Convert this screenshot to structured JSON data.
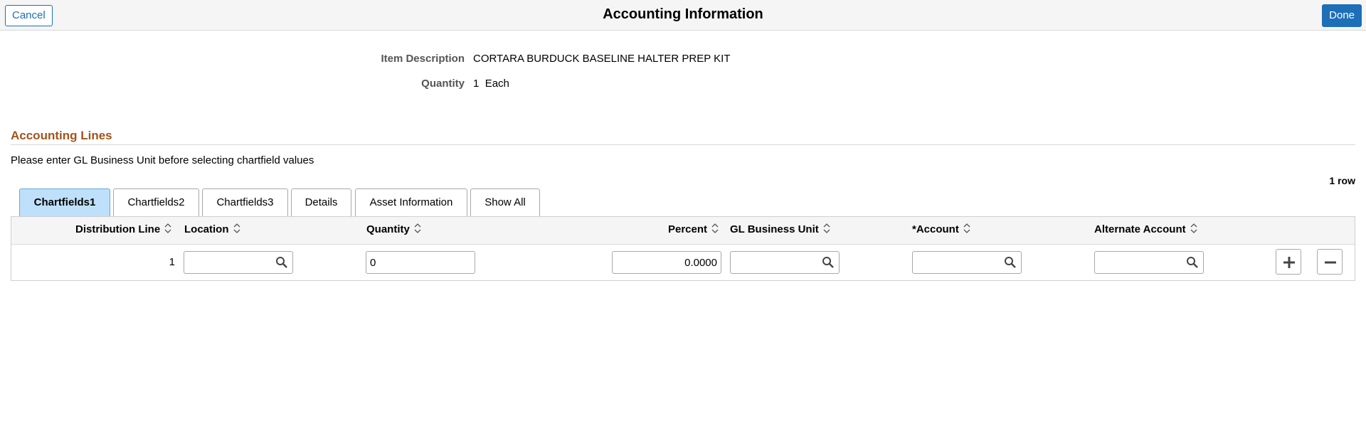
{
  "header": {
    "title": "Accounting Information",
    "cancel_label": "Cancel",
    "done_label": "Done"
  },
  "item_info": {
    "description_label": "Item Description",
    "description_value": "CORTARA BURDUCK BASELINE HALTER PREP KIT",
    "quantity_label": "Quantity",
    "quantity_value": "1",
    "quantity_unit": "Each"
  },
  "accounting_lines": {
    "section_title": "Accounting Lines",
    "instruction": "Please enter GL Business Unit before selecting chartfield values",
    "row_count": "1 row",
    "tabs": [
      {
        "label": "Chartfields1",
        "active": true
      },
      {
        "label": "Chartfields2",
        "active": false
      },
      {
        "label": "Chartfields3",
        "active": false
      },
      {
        "label": "Details",
        "active": false
      },
      {
        "label": "Asset Information",
        "active": false
      },
      {
        "label": "Show All",
        "active": false
      }
    ],
    "columns": {
      "distribution_line": "Distribution Line",
      "location": "Location",
      "quantity": "Quantity",
      "percent": "Percent",
      "gl_business_unit": "GL Business Unit",
      "account": "*Account",
      "alternate_account": "Alternate Account"
    },
    "rows": [
      {
        "distribution_line": "1",
        "location": "",
        "quantity": "0",
        "percent": "0.0000",
        "gl_business_unit": "",
        "account": "",
        "alternate_account": ""
      }
    ]
  },
  "icons": {
    "lookup": "search-icon",
    "sort": "sort-icon",
    "add_row": "plus-icon",
    "delete_row": "minus-icon"
  },
  "colors": {
    "accent_blue": "#1d6fb8",
    "section_title": "#a4531a",
    "active_tab": "#bfe0fa"
  }
}
